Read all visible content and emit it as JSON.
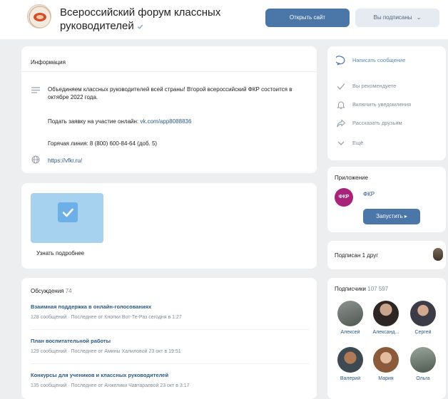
{
  "header": {
    "title": "Всероссийский форум классных руководителей",
    "open_site_button": "Открыть сайт",
    "subscribed_button": "Вы подписаны"
  },
  "info": {
    "title": "Информация",
    "description": "Объединяем классных руководителей всей страны! Второй всероссийский ФКР состоится в октябре 2022 года.",
    "apply_prefix": "Подать заявку на участие онлайн: ",
    "apply_link": "vk.com/app8088836",
    "hotline": "Горячая линия: 8 (800) 600-84-64 (доб. 5)",
    "website": "https://vfkr.ru/"
  },
  "widget": {
    "label": "Узнать подробнее"
  },
  "discussions": {
    "title": "Обсуждения",
    "count": "74",
    "items": [
      {
        "title": "Взаимная поддержка в онлайн-голосованиях",
        "meta": "128 сообщений · Последнее от Кнопки Вот-Те-Раз сегодня в 1:27"
      },
      {
        "title": "План воспитательной работы",
        "meta": "129 сообщений · Последнее от Амины Халиловой 23 окт в 19:51"
      },
      {
        "title": "Конкурсы для учеников и классных руководителей",
        "meta": "135 сообщений · Последнее от Анжелики Чавтараевой 23 окт в 3:17"
      }
    ]
  },
  "actions": {
    "write_message": "Написать сообщение",
    "recommend": "Вы рекомендуете",
    "notifications": "Включить уведомления",
    "share": "Рассказать друзьям",
    "more": "Ещё"
  },
  "app": {
    "section_title": "Приложение",
    "logo_text": "ФКР",
    "name": "ФКР",
    "launch_button": "Запустить ▸"
  },
  "friends": {
    "label": "Подписан 1 друг"
  },
  "subscribers": {
    "title": "Подписчики",
    "count": "107 597",
    "people": [
      {
        "name": "Алексей",
        "color": "#6a6f66"
      },
      {
        "name": "Александ...",
        "color": "#3a2e28"
      },
      {
        "name": "Сергей",
        "color": "#5b4a44"
      },
      {
        "name": "Валерий",
        "color": "#8a5a3c"
      },
      {
        "name": "Мария",
        "color": "#b07f61"
      },
      {
        "name": "Ольга",
        "color": "#6f7a6e"
      }
    ]
  },
  "colors": {
    "accent": "#4a76a8",
    "link": "#2a5885",
    "background": "#edeef0",
    "app_logo": "#a8247a"
  }
}
